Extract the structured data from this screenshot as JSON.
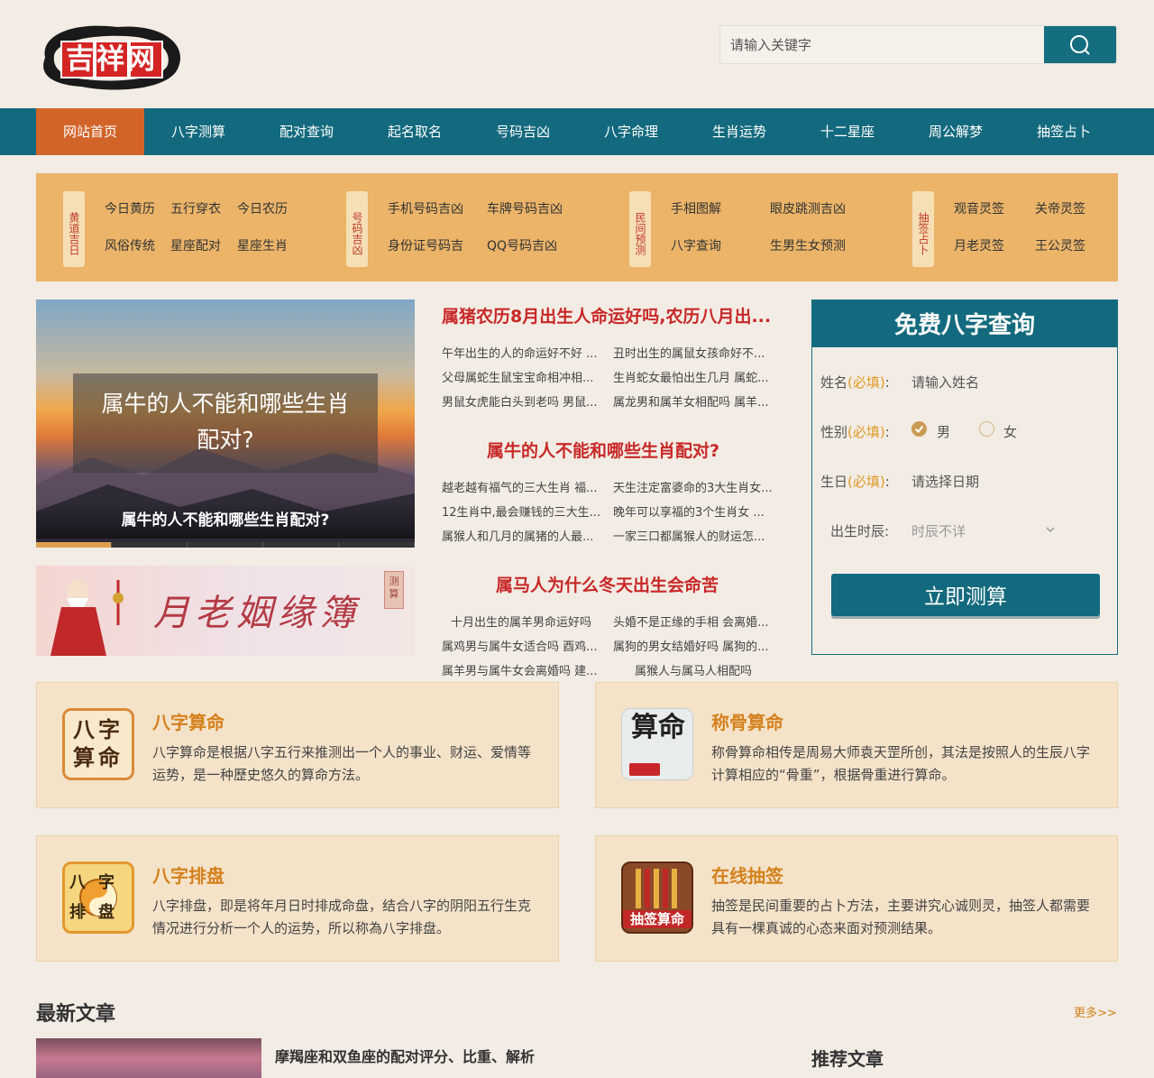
{
  "header": {
    "logo_text": "吉祥网",
    "search_placeholder": "请输入关键字"
  },
  "nav": [
    {
      "label": "网站首页",
      "active": true
    },
    {
      "label": "八字测算"
    },
    {
      "label": "配对查询"
    },
    {
      "label": "起名取名"
    },
    {
      "label": "号码吉凶"
    },
    {
      "label": "八字命理"
    },
    {
      "label": "生肖运势"
    },
    {
      "label": "十二星座"
    },
    {
      "label": "周公解梦"
    },
    {
      "label": "抽签占卜"
    }
  ],
  "categories": [
    {
      "tag": "黄道吉日",
      "links": [
        "今日黄历",
        "五行穿衣",
        "今日农历",
        "风俗传统",
        "星座配对",
        "星座生肖"
      ]
    },
    {
      "tag": "号码吉凶",
      "links": [
        "手机号码吉凶",
        "车牌号码吉凶",
        "身份证号码吉",
        "QQ号码吉凶"
      ]
    },
    {
      "tag": "民间预测",
      "links": [
        "手相图解",
        "眼皮跳测吉凶",
        "八字查询",
        "生男生女预测"
      ]
    },
    {
      "tag": "抽签占卜",
      "links": [
        "观音灵签",
        "关帝灵签",
        "月老灵签",
        "王公灵签"
      ]
    }
  ],
  "banner": {
    "overlay": "属牛的人不能和哪些生肖配对?",
    "caption": "属牛的人不能和哪些生肖配对?"
  },
  "ad": {
    "title": "月老姻缘簿",
    "stamp": "测算"
  },
  "articles": {
    "group1": {
      "headline": "属猪农历8月出生人命运好吗,农历八月出...",
      "items": [
        "午年出生的人的命运好不好 ...",
        "丑时出生的属鼠女孩命好不...",
        "父母属蛇生鼠宝宝命相冲相...",
        "生肖蛇女最怕出生几月 属蛇...",
        "男鼠女虎能白头到老吗 男鼠...",
        "属龙男和属羊女相配吗 属羊..."
      ]
    },
    "group2": {
      "headline": "属牛的人不能和哪些生肖配对?",
      "items": [
        "越老越有福气的三大生肖 福...",
        "天生注定富婆命的3大生肖女...",
        "12生肖中,最会赚钱的三大生...",
        "晚年可以享福的3个生肖女 ...",
        "属猴人和几月的属猪的人最...",
        "一家三口都属猴人的财运怎..."
      ]
    },
    "group3": {
      "headline": "属马人为什么冬天出生会命苦",
      "items": [
        "十月出生的属羊男命运好吗",
        "头婚不是正缘的手相 会离婚...",
        "属鸡男与属牛女适合吗 酉鸡...",
        "属狗的男女结婚好吗 属狗的...",
        "属羊男与属牛女会离婚吗 建...",
        "属猴人与属马人相配吗"
      ]
    }
  },
  "form": {
    "title": "免费八字查询",
    "name_label": "姓名",
    "required": "(必填)",
    "name_placeholder": "请输入姓名",
    "gender_label": "性别",
    "male": "男",
    "female": "女",
    "birthday_label": "生日",
    "birthday_placeholder": "请选择日期",
    "hour_label": "出生时辰:",
    "hour_value": "时辰不详",
    "submit": "立即测算"
  },
  "cards": [
    {
      "title": "八字算命",
      "icon": "bazi-suanming-icon",
      "icon_text": "八字算命",
      "desc": "八字算命是根据八字五行来推测出一个人的事业、财运、爱情等运势，是一种歷史悠久的算命方法。"
    },
    {
      "title": "称骨算命",
      "icon": "chenggu-icon",
      "icon_text": "算命",
      "desc": "称骨算命相传是周易大师袁天罡所创，其法是按照人的生辰八字计算相应的“骨重”，根据骨重进行算命。"
    },
    {
      "title": "八字排盘",
      "icon": "bazi-paipan-icon",
      "icon_text": "八字排盘",
      "desc": "八字排盘，即是将年月日时排成命盘，结合八字的阴阳五行生克情况进行分析一个人的运势，所以称為八字排盘。"
    },
    {
      "title": "在线抽签",
      "icon": "chouqian-icon",
      "icon_text": "抽签算命",
      "desc": "抽签是民间重要的占卜方法，主要讲究心诚则灵，抽签人都需要具有一棵真诚的心态来面对预测结果。"
    }
  ],
  "latest": {
    "title": "最新文章",
    "more": "更多>>",
    "first_article": "摩羯座和双鱼座的配对评分、比重、解析"
  },
  "recommend": {
    "title": "推荐文章"
  },
  "colors": {
    "teal": "#136a7e",
    "orange_active": "#d2642a",
    "band": "#ebb469",
    "headline_red": "#c82828",
    "card_title": "#d4811d"
  }
}
